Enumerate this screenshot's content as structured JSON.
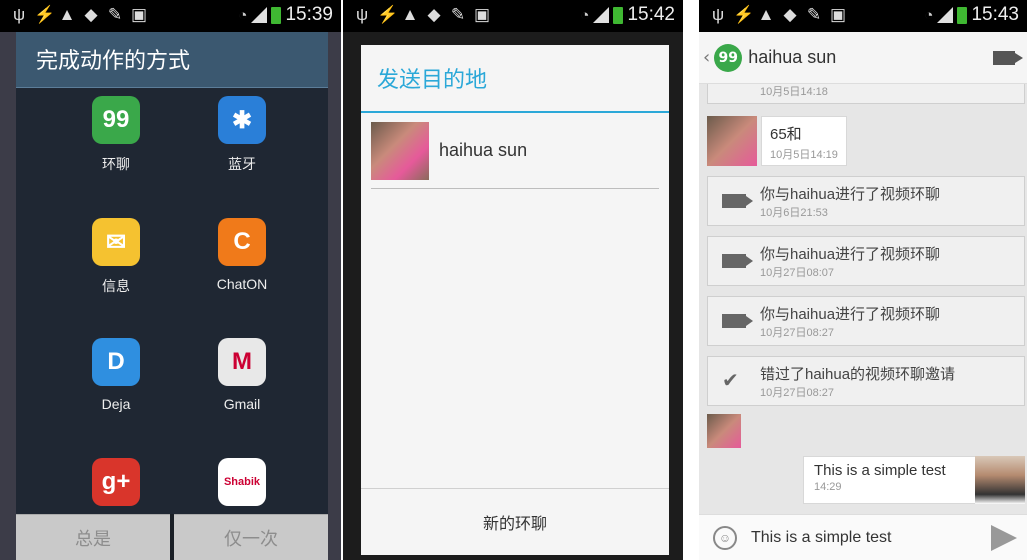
{
  "panel1": {
    "time": "15:39",
    "title": "完成动作的方式",
    "apps": [
      {
        "label": "环聊",
        "icon": "hangouts-icon",
        "color": "#3aa84a",
        "glyph": "99"
      },
      {
        "label": "蓝牙",
        "icon": "bluetooth-icon",
        "color": "#2a7fd8",
        "glyph": "✱"
      },
      {
        "label": "信息",
        "icon": "messages-icon",
        "color": "#f5c230",
        "glyph": "✉"
      },
      {
        "label": "ChatON",
        "icon": "chaton-icon",
        "color": "#f07a1a",
        "glyph": "C"
      },
      {
        "label": "Deja",
        "icon": "deja-icon",
        "color": "#2f8fe0",
        "glyph": "D"
      },
      {
        "label": "Gmail",
        "icon": "gmail-icon",
        "color": "#e8e8e8",
        "glyph": "M"
      },
      {
        "label": "",
        "icon": "google-plus-icon",
        "color": "#d9352b",
        "glyph": "g+"
      },
      {
        "label": "",
        "icon": "shabik-icon",
        "color": "#ffffff",
        "glyph": "Shabik"
      }
    ],
    "btn_always": "总是",
    "btn_once": "仅一次"
  },
  "panel2": {
    "time": "15:42",
    "title": "发送目的地",
    "contact_name": "haihua sun",
    "new_hangout": "新的环聊"
  },
  "panel3": {
    "time": "15:43",
    "contact_name": "haihua sun",
    "top_timestamp": "10月5日14:18",
    "msg1_text": "65和",
    "msg1_time": "10月5日14:19",
    "events": [
      {
        "text": "你与haihua进行了视频环聊",
        "time": "10月6日21:53",
        "icon": "video-camera-icon"
      },
      {
        "text": "你与haihua进行了视频环聊",
        "time": "10月27日08:07",
        "icon": "video-camera-icon"
      },
      {
        "text": "你与haihua进行了视频环聊",
        "time": "10月27日08:27",
        "icon": "video-camera-icon"
      },
      {
        "text": "错过了haihua的视频环聊邀请",
        "time": "10月27日08:27",
        "icon": "missed-call-icon"
      }
    ],
    "my_msg_text": "This is a simple test",
    "my_msg_time": "14:29",
    "input_value": "This is a simple test"
  }
}
